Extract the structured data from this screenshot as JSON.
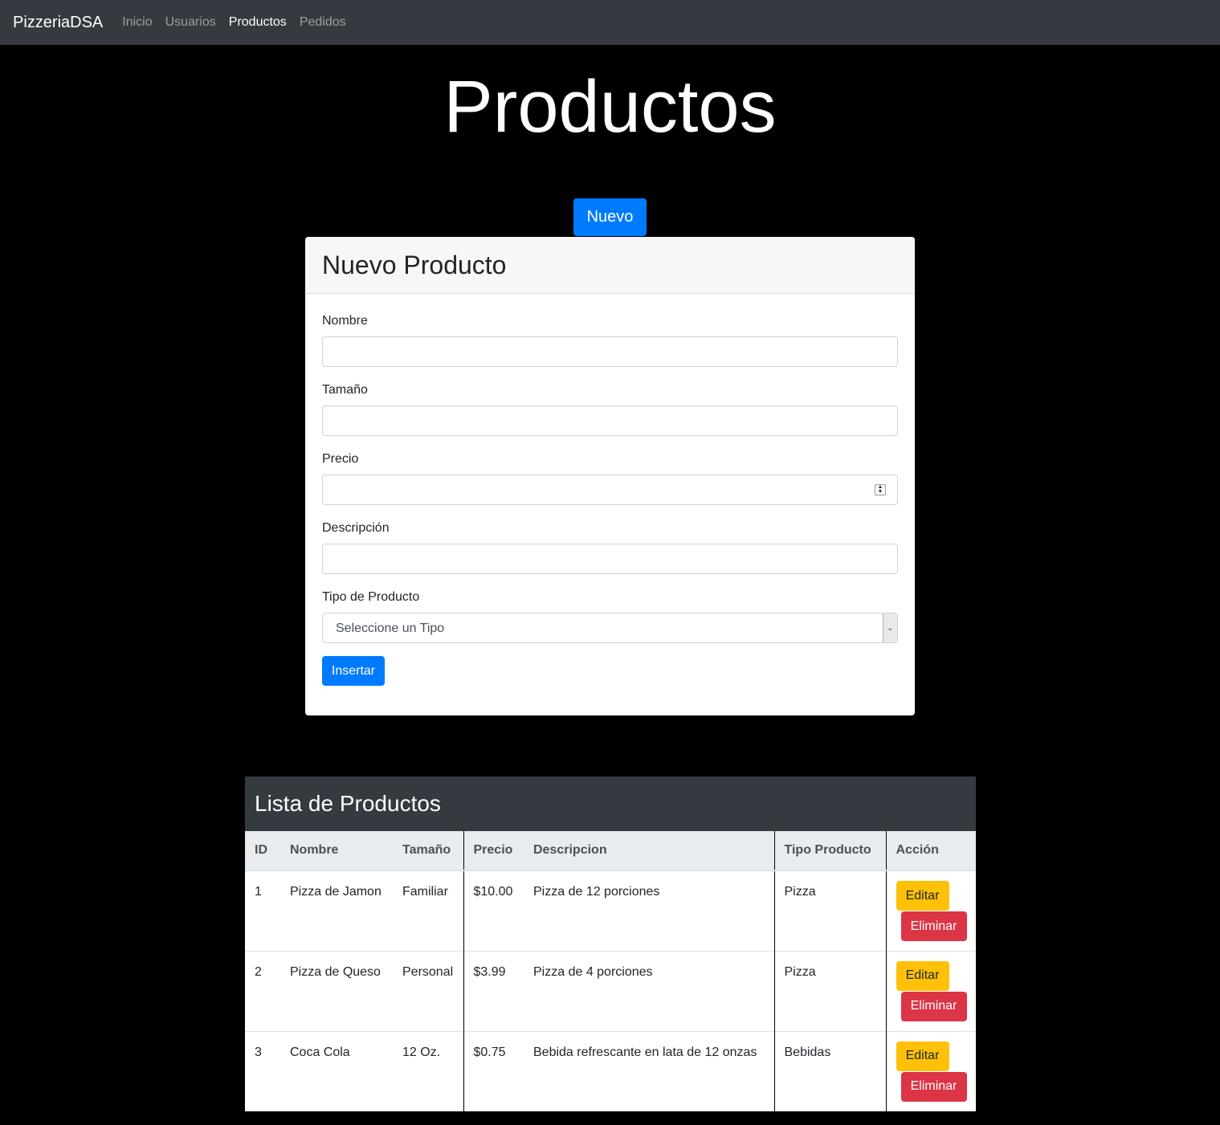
{
  "navbar": {
    "brand": "PizzeriaDSA",
    "items": [
      {
        "label": "Inicio",
        "active": false
      },
      {
        "label": "Usuarios",
        "active": false
      },
      {
        "label": "Productos",
        "active": true
      },
      {
        "label": "Pedidos",
        "active": false
      }
    ]
  },
  "page": {
    "title": "Productos",
    "new_button": "Nuevo"
  },
  "form": {
    "title": "Nuevo Producto",
    "fields": {
      "nombre": {
        "label": "Nombre",
        "value": ""
      },
      "tamano": {
        "label": "Tamaño",
        "value": ""
      },
      "precio": {
        "label": "Precio",
        "value": ""
      },
      "descripcion": {
        "label": "Descripción",
        "value": ""
      },
      "tipo": {
        "label": "Tipo de Producto",
        "selected": "Seleccione un Tipo"
      }
    },
    "submit": "Insertar"
  },
  "table": {
    "title": "Lista de Productos",
    "columns": [
      "ID",
      "Nombre",
      "Tamaño",
      "Precio",
      "Descripcion",
      "Tipo Producto",
      "Acción"
    ],
    "rows": [
      {
        "id": "1",
        "nombre": "Pizza de Jamon",
        "tamano": "Familiar",
        "precio": "$10.00",
        "descripcion": "Pizza de 12 porciones",
        "tipo": "Pizza"
      },
      {
        "id": "2",
        "nombre": "Pizza de Queso",
        "tamano": "Personal",
        "precio": "$3.99",
        "descripcion": "Pizza de 4 porciones",
        "tipo": "Pizza"
      },
      {
        "id": "3",
        "nombre": "Coca Cola",
        "tamano": "12 Oz.",
        "precio": "$0.75",
        "descripcion": "Bebida refrescante en lata de 12 onzas",
        "tipo": "Bebidas"
      }
    ],
    "actions": {
      "edit": "Editar",
      "delete": "Eliminar"
    }
  }
}
